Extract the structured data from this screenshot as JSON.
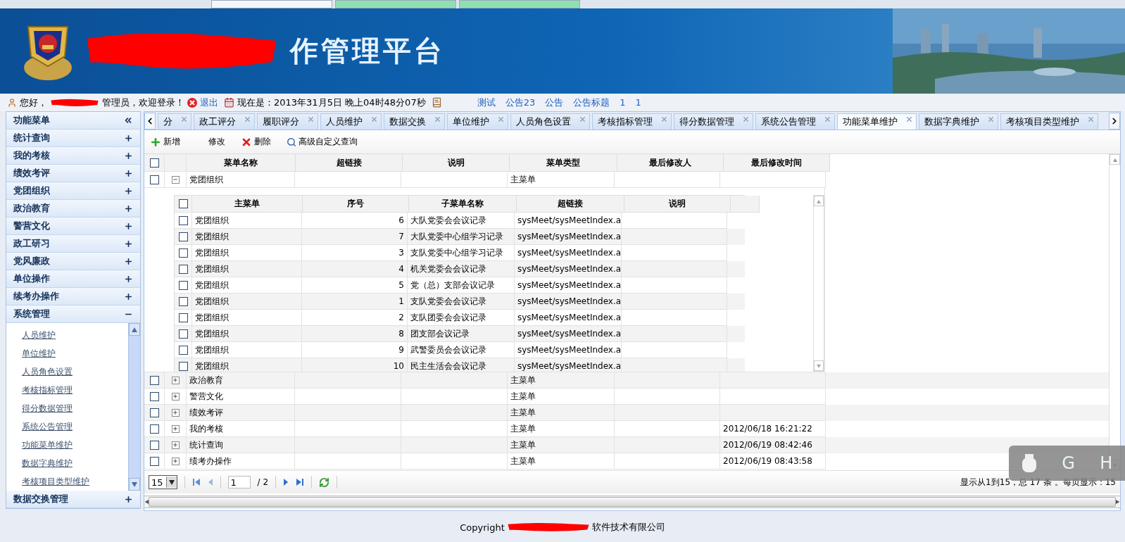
{
  "browser_tabs": [
    {
      "selected": true
    },
    {
      "selected": false
    },
    {
      "selected": false
    }
  ],
  "header": {
    "title": "作管理平台"
  },
  "info_bar": {
    "greeting_prefix": "您好，",
    "greeting_suffix": "管理员，欢迎登录！",
    "logout": "退出",
    "clock": "现在是：2013年31月5日 晚上04时48分07秒",
    "notices": [
      "测试",
      "公告23",
      "公告",
      "公告标题",
      "1",
      "1"
    ]
  },
  "sidebar": {
    "title": "功能菜单",
    "groups": [
      {
        "label": "统计查询",
        "expanded": false
      },
      {
        "label": "我的考核",
        "expanded": false
      },
      {
        "label": "绩效考评",
        "expanded": false
      },
      {
        "label": "党团组织",
        "expanded": false
      },
      {
        "label": "政治教育",
        "expanded": false
      },
      {
        "label": "警营文化",
        "expanded": false
      },
      {
        "label": "政工研习",
        "expanded": false
      },
      {
        "label": "党风廉政",
        "expanded": false
      },
      {
        "label": "单位操作",
        "expanded": false
      },
      {
        "label": "续考办操作",
        "expanded": false
      },
      {
        "label": "系统管理",
        "expanded": true,
        "items": [
          "人员维护",
          "单位维护",
          "人员角色设置",
          "考核指标管理",
          "得分数据管理",
          "系统公告管理",
          "功能菜单维护",
          "数据字典维护",
          "考核项目类型维护"
        ]
      },
      {
        "label": "数据交换管理",
        "expanded": false
      }
    ]
  },
  "tabs": [
    {
      "label": "分",
      "selected": false
    },
    {
      "label": "政工评分",
      "selected": false
    },
    {
      "label": "履职评分",
      "selected": false
    },
    {
      "label": "人员维护",
      "selected": false
    },
    {
      "label": "数据交换",
      "selected": false
    },
    {
      "label": "单位维护",
      "selected": false
    },
    {
      "label": "人员角色设置",
      "selected": false
    },
    {
      "label": "考核指标管理",
      "selected": false
    },
    {
      "label": "得分数据管理",
      "selected": false
    },
    {
      "label": "系统公告管理",
      "selected": false
    },
    {
      "label": "功能菜单维护",
      "selected": true
    },
    {
      "label": "数据字典维护",
      "selected": false
    },
    {
      "label": "考核项目类型维护",
      "selected": false
    }
  ],
  "toolbar": [
    {
      "kind": "add",
      "label": "新增"
    },
    {
      "kind": "edit",
      "label": "修改"
    },
    {
      "kind": "delete",
      "label": "删除"
    },
    {
      "kind": "search",
      "label": "高级自定义查询"
    }
  ],
  "grid": {
    "all_checked": false,
    "columns": [
      "菜单名称",
      "超链接",
      "说明",
      "菜单类型",
      "最后修改人",
      "最后修改时间"
    ],
    "rows": [
      {
        "checked": false,
        "expanded": true,
        "cells": [
          "党团组织",
          "",
          "",
          "主菜单",
          "",
          ""
        ],
        "subgrid": {
          "all_checked": false,
          "columns": [
            "主菜单",
            "序号",
            "子菜单名称",
            "超链接",
            "说明"
          ],
          "rows": [
            {
              "checked": false,
              "cells": [
                "党团组织",
                "6",
                "大队党委会会议记录",
                "sysMeet/sysMeetIndex.a",
                ""
              ]
            },
            {
              "checked": false,
              "cells": [
                "党团组织",
                "7",
                "大队党委中心组学习记录",
                "sysMeet/sysMeetIndex.a",
                ""
              ]
            },
            {
              "checked": false,
              "cells": [
                "党团组织",
                "3",
                "支队党委中心组学习记录",
                "sysMeet/sysMeetIndex.a",
                ""
              ]
            },
            {
              "checked": false,
              "cells": [
                "党团组织",
                "4",
                "机关党委会会议记录",
                "sysMeet/sysMeetIndex.a",
                ""
              ]
            },
            {
              "checked": false,
              "cells": [
                "党团组织",
                "5",
                "党（总）支部会议记录",
                "sysMeet/sysMeetIndex.a",
                ""
              ]
            },
            {
              "checked": false,
              "cells": [
                "党团组织",
                "1",
                "支队党委会会议记录",
                "sysMeet/sysMeetIndex.a",
                ""
              ]
            },
            {
              "checked": false,
              "cells": [
                "党团组织",
                "2",
                "支队团委会会议记录",
                "sysMeet/sysMeetIndex.a",
                ""
              ]
            },
            {
              "checked": false,
              "cells": [
                "党团组织",
                "8",
                "团支部会议记录",
                "sysMeet/sysMeetIndex.a",
                ""
              ]
            },
            {
              "checked": false,
              "cells": [
                "党团组织",
                "9",
                "武警委员会会议记录",
                "sysMeet/sysMeetIndex.a",
                ""
              ]
            },
            {
              "checked": false,
              "cells": [
                "党团组织",
                "10",
                "民主生活会会议记录",
                "sysMeet/sysMeetIndex.a",
                ""
              ]
            }
          ]
        }
      },
      {
        "checked": false,
        "expanded": false,
        "cells": [
          "政治教育",
          "",
          "",
          "主菜单",
          "",
          ""
        ]
      },
      {
        "checked": false,
        "expanded": false,
        "cells": [
          "警营文化",
          "",
          "",
          "主菜单",
          "",
          ""
        ]
      },
      {
        "checked": false,
        "expanded": false,
        "cells": [
          "绩效考评",
          "",
          "",
          "主菜单",
          "",
          ""
        ]
      },
      {
        "checked": false,
        "expanded": false,
        "cells": [
          "我的考核",
          "",
          "",
          "主菜单",
          "",
          "2012/06/18 16:21:22"
        ]
      },
      {
        "checked": false,
        "expanded": false,
        "cells": [
          "统计查询",
          "",
          "",
          "主菜单",
          "",
          "2012/06/19 08:42:46"
        ]
      },
      {
        "checked": false,
        "expanded": false,
        "cells": [
          "绩考办操作",
          "",
          "",
          "主菜单",
          "",
          "2012/06/19 08:43:58"
        ]
      }
    ]
  },
  "pager": {
    "page_size": "15",
    "page": "1",
    "total_pages": "/ 2",
    "summary": "显示从1到15，总 17 条 。每页显示：15"
  },
  "footer": {
    "prefix": "Copyright",
    "suffix": "软件技术有限公司"
  },
  "overlay": {
    "keys": [
      "G",
      "H"
    ]
  }
}
